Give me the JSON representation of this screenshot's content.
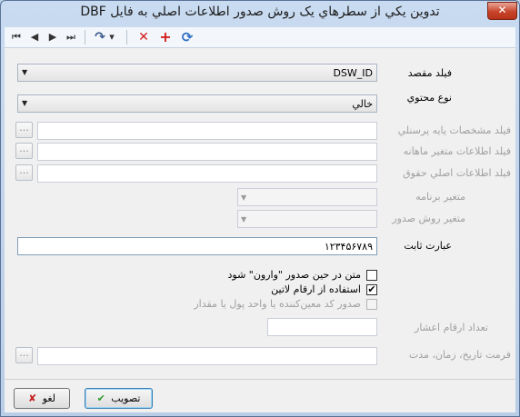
{
  "window": {
    "title": "تدوين يکي از سطرهاي يک روش صدور اطلاعات اصلي به فايل DBF",
    "close_glyph": "✕"
  },
  "toolbar": {
    "first": "⏮",
    "prev": "◀",
    "next": "▶",
    "last": "⏭",
    "redo": "↷",
    "dropdown": "▾",
    "delete": "✕",
    "add": "+",
    "refresh": "⟳",
    "colors": {
      "delete": "#d21f1f",
      "add": "#d21f1f",
      "refresh": "#2f6fc3"
    }
  },
  "form": {
    "target_field": {
      "label": "فيلد مقصد",
      "value": "DSW_ID"
    },
    "content_type": {
      "label": "نوع محتوي",
      "value": "خالي"
    },
    "personnel_field": {
      "label": "فيلد مشخصات پايه پرسنلي",
      "value": ""
    },
    "monthly_field": {
      "label": "فيلد اطلاعات متغير ماهانه",
      "value": ""
    },
    "salary_field": {
      "label": "فيلد اطلاعات اصلي حقوق",
      "value": ""
    },
    "program_var": {
      "label": "متغير برنامه"
    },
    "export_var": {
      "label": "متغير روش صدور"
    },
    "constant": {
      "label": "عبارت ثابت",
      "value": "۱۲۳۴۵۶۷۸۹"
    },
    "reverse_text": {
      "label": "متن در حين صدور \"وارون\" شود",
      "checked": false
    },
    "latin_digits": {
      "label": "استفاده از ارقام لاتين",
      "checked": true,
      "mark": "✔"
    },
    "currency_code": {
      "label": "صدور کد معين‌کننده يا واحد پول يا مقدار",
      "checked": false
    },
    "decimal_digits": {
      "label": "تعداد ارقام اعشار",
      "value": ""
    },
    "date_format": {
      "label": "فرمت تاريخ، زمان، مدت",
      "value": ""
    },
    "ellipsis": "..."
  },
  "buttons": {
    "ok": {
      "label": "تصويب",
      "icon": "✔",
      "icon_color": "#2e9a2e"
    },
    "cancel": {
      "label": "لغو",
      "icon": "✘",
      "icon_color": "#c41e1e"
    }
  }
}
